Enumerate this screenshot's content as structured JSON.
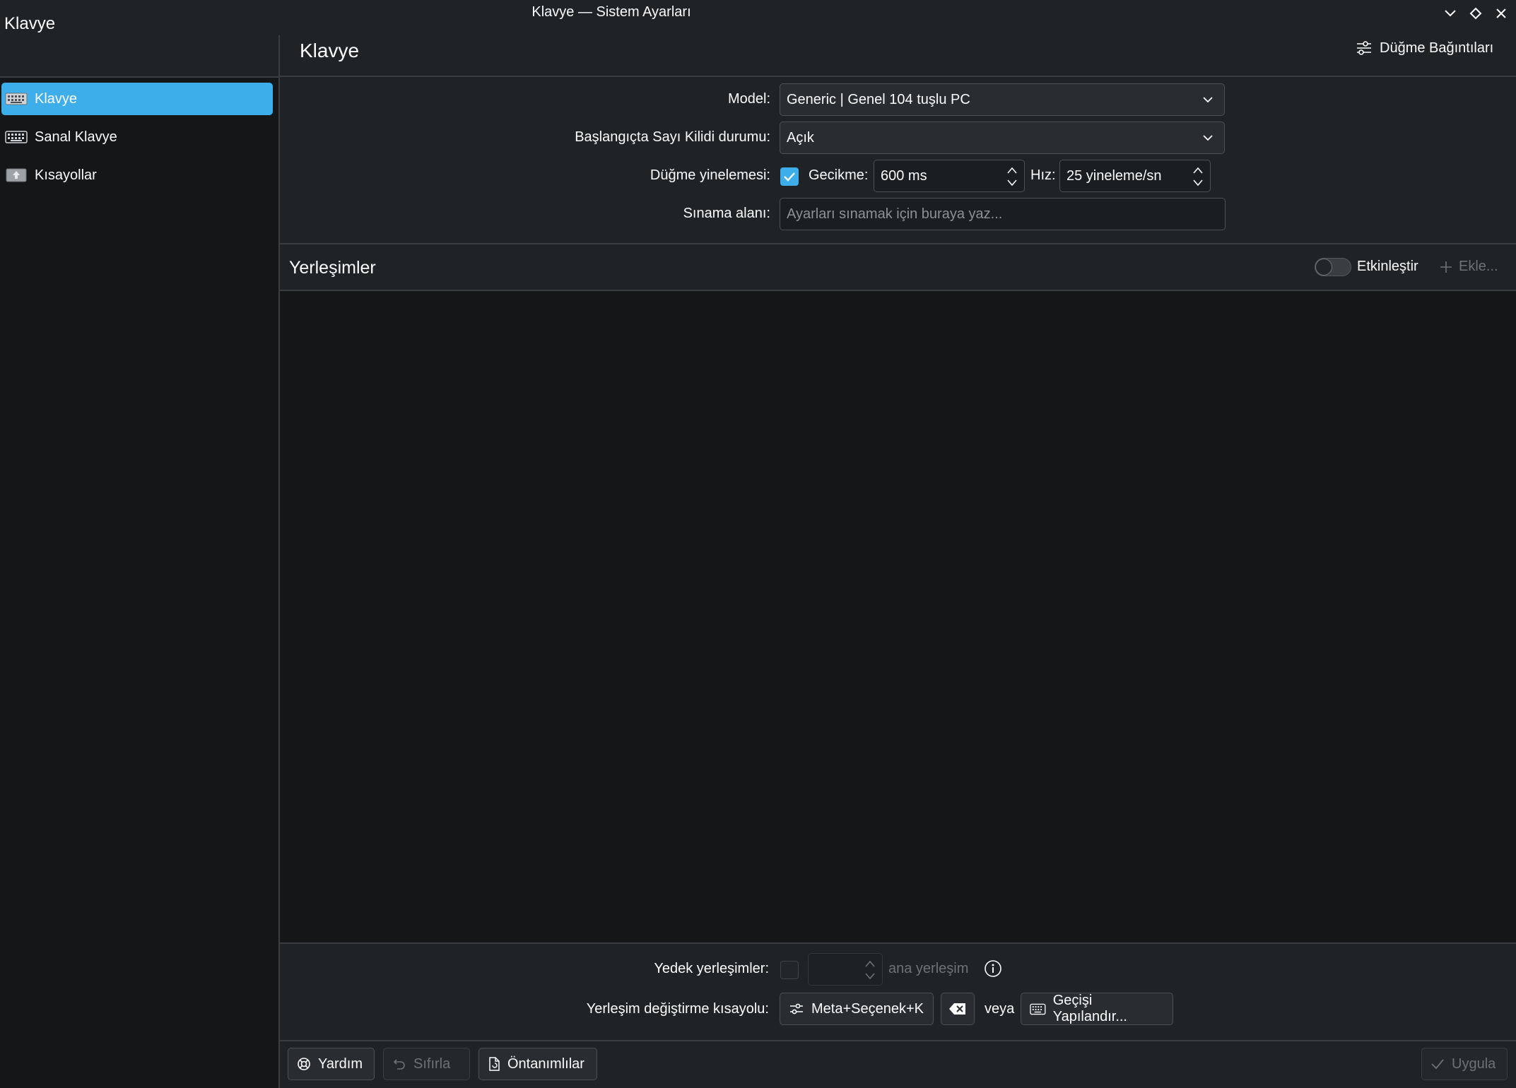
{
  "window": {
    "title": "Klavye — Sistem Ayarları"
  },
  "sidebar": {
    "title": "Klavye",
    "items": [
      {
        "label": "Klavye",
        "icon": "keyboard-icon",
        "selected": true
      },
      {
        "label": "Sanal Klavye",
        "icon": "virtual-keyboard-icon",
        "selected": false
      },
      {
        "label": "Kısayollar",
        "icon": "shortcuts-icon",
        "selected": false
      }
    ]
  },
  "header": {
    "title": "Klavye",
    "bindings_button": "Düğme Bağıntıları"
  },
  "form": {
    "model_label": "Model:",
    "model_value": "Generic | Genel 104 tuşlu PC",
    "numlock_label": "Başlangıçta Sayı Kilidi durumu:",
    "numlock_value": "Açık",
    "repeat_label": "Düğme yinelemesi:",
    "repeat_checked": true,
    "delay_label": "Gecikme:",
    "delay_value": "600 ms",
    "rate_label": "Hız:",
    "rate_value": "25 yineleme/sn",
    "test_label": "Sınama alanı:",
    "test_placeholder": "Ayarları sınamak için buraya yaz..."
  },
  "layouts": {
    "title": "Yerleşimler",
    "enable_label": "Etkinleştir",
    "enabled": false,
    "add_label": "Ekle..."
  },
  "spare": {
    "label": "Yedek yerleşimler:",
    "suffix": "ana yerleşim"
  },
  "switching": {
    "label": "Yerleşim değiştirme kısayolu:",
    "shortcut": "Meta+Seçenek+K",
    "or_label": "veya",
    "configure_label": "Geçişi Yapılandır..."
  },
  "footer": {
    "help": "Yardım",
    "reset": "Sıfırla",
    "defaults": "Öntanımlılar",
    "apply": "Uygula"
  },
  "colors": {
    "accent": "#3daee9",
    "window_bg": "#202326",
    "view_bg": "#141618"
  }
}
